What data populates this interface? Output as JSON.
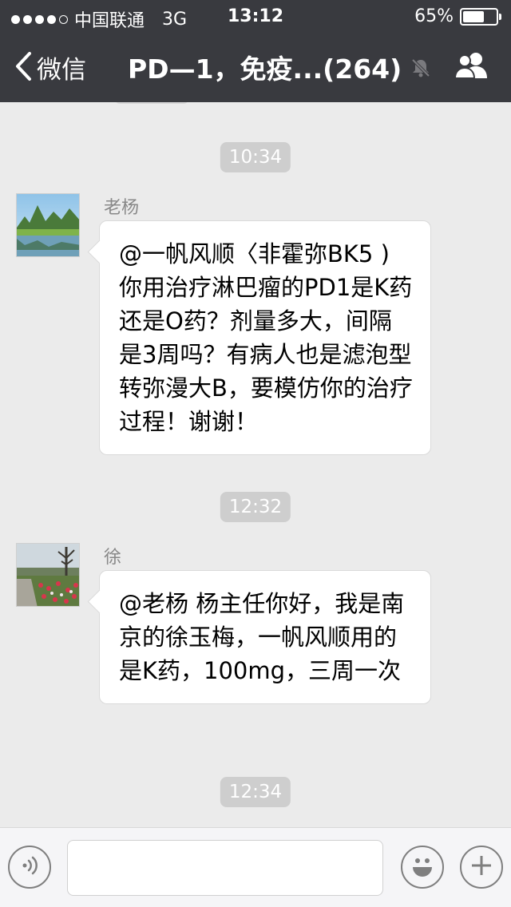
{
  "status_bar": {
    "carrier": "中国联通",
    "network": "3G",
    "time": "13:12",
    "battery_percent": "65%",
    "battery_level": 0.65,
    "signal_strength": 4
  },
  "nav": {
    "back_label": "微信",
    "title": "PD—1，免疫...(264)"
  },
  "chat": {
    "messages": [
      {
        "time": "10:34",
        "sender": "老杨",
        "text": "@一帆风顺〈非霍弥BK5 ) 你用治疗淋巴瘤的PD1是K药还是O药？剂量多大，间隔是3周吗？有病人也是滤泡型转弥漫大B，要模仿你的治疗过程！谢谢！"
      },
      {
        "time": "12:32",
        "sender": "徐",
        "text": "@老杨 杨主任你好，我是南京的徐玉梅，一帆风顺用的是K药，100mg，三周一次"
      }
    ],
    "last_time": "12:34"
  },
  "colors": {
    "nav_bg": "#393a3f",
    "chat_bg": "#ebebeb",
    "time_pill": "#cecece"
  }
}
